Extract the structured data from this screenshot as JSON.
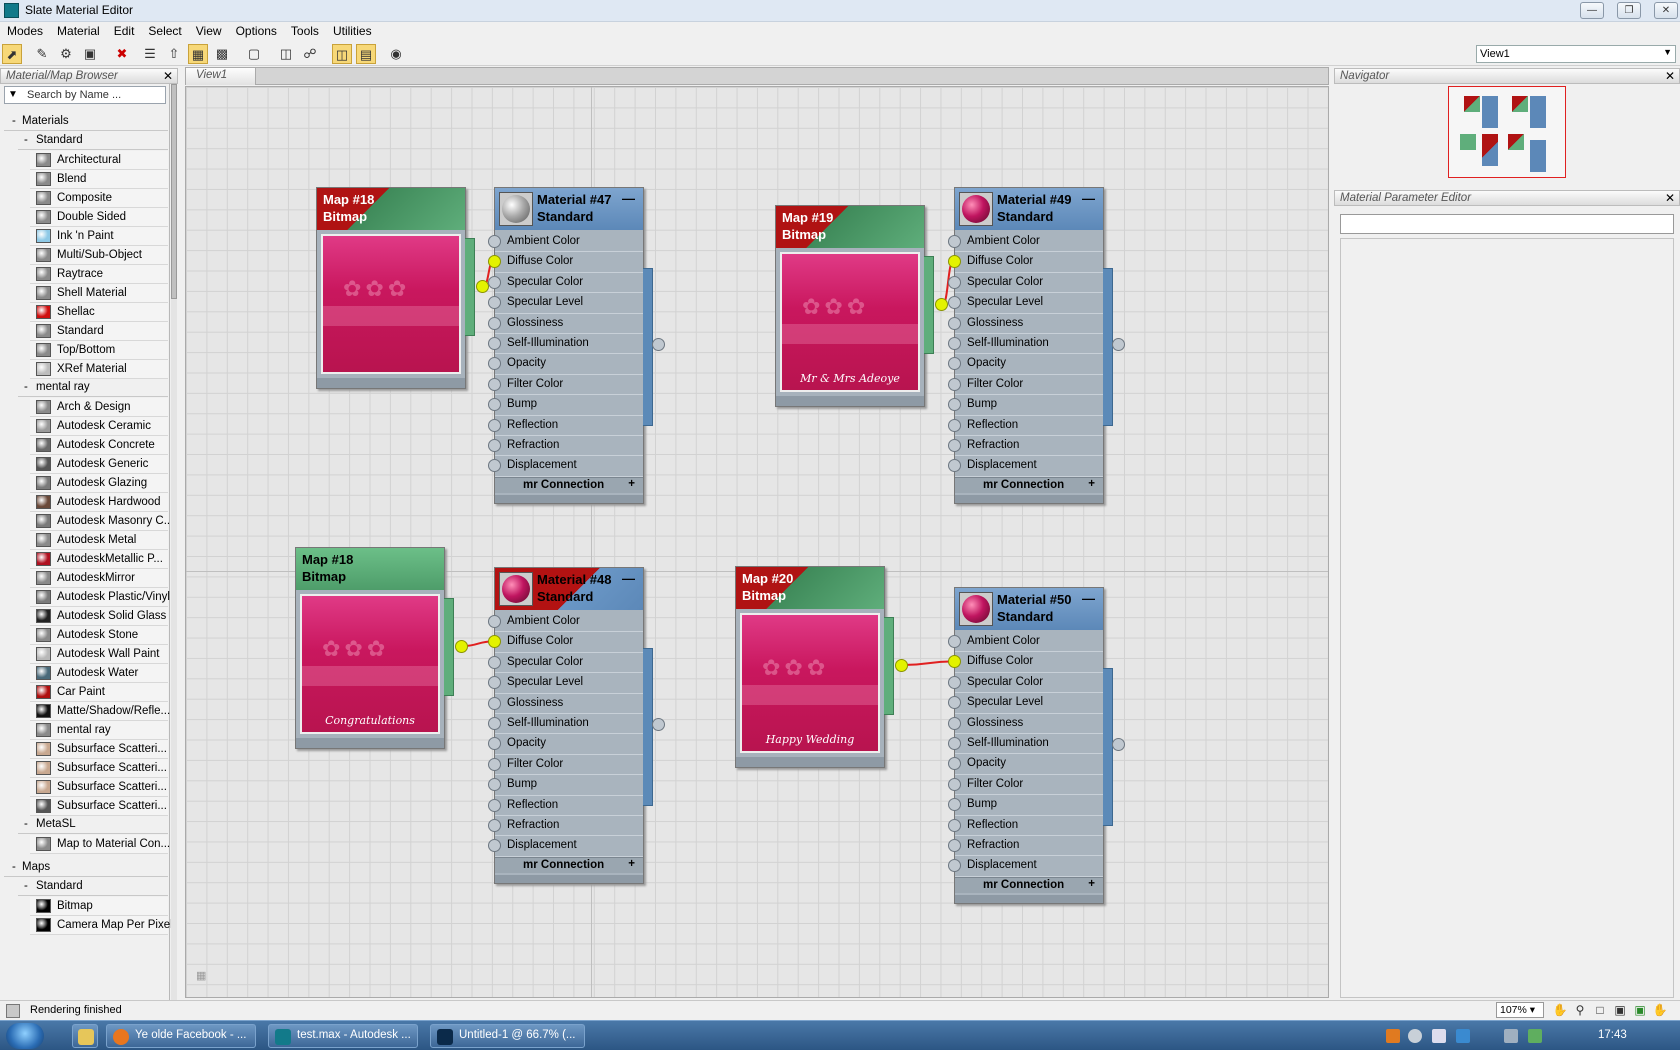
{
  "window": {
    "title": "Slate Material Editor"
  },
  "menu": [
    "Modes",
    "Material",
    "Edit",
    "Select",
    "View",
    "Options",
    "Tools",
    "Utilities"
  ],
  "toolbar": {
    "icons": [
      "select-arrow-icon",
      "pick-material-icon",
      "put-to-scene-icon",
      "assign-to-selection-icon",
      "delete-icon",
      "move-children-icon",
      "hide-unused-slots-icon",
      "show-map-in-viewport-icon",
      "show-background-icon",
      "material-id-icon",
      "layout-all-icon",
      "layout-children-icon",
      "material-map-browser-toggle-icon",
      "parameter-editor-toggle-icon",
      "select-by-material-icon"
    ],
    "view_select": "View1"
  },
  "browser": {
    "title": "Material/Map Browser",
    "search_placeholder": "Search by Name ...",
    "sections": [
      {
        "label": "Materials",
        "sign": "-",
        "groups": [
          {
            "label": "Standard",
            "sign": "-",
            "items": [
              {
                "label": "Architectural",
                "swatch": "#8a8a8a"
              },
              {
                "label": "Blend",
                "swatch": "#8a8a8a"
              },
              {
                "label": "Composite",
                "swatch": "#8a8a8a"
              },
              {
                "label": "Double Sided",
                "swatch": "#8a8a8a"
              },
              {
                "label": "Ink 'n Paint",
                "swatch": "#8ec9e6"
              },
              {
                "label": "Multi/Sub-Object",
                "swatch": "#8a8a8a"
              },
              {
                "label": "Raytrace",
                "swatch": "#8a8a8a"
              },
              {
                "label": "Shell Material",
                "swatch": "#8a8a8a"
              },
              {
                "label": "Shellac",
                "swatch": "#d01010"
              },
              {
                "label": "Standard",
                "swatch": "#8a8a8a"
              },
              {
                "label": "Top/Bottom",
                "swatch": "#8a8a8a"
              },
              {
                "label": "XRef Material",
                "swatch": "#bdbdbd"
              }
            ]
          },
          {
            "label": "mental ray",
            "sign": "-",
            "items": [
              {
                "label": "Arch & Design",
                "swatch": "#8a8a8a"
              },
              {
                "label": "Autodesk Ceramic",
                "swatch": "#9a9a9a"
              },
              {
                "label": "Autodesk Concrete",
                "swatch": "#6a6a6a"
              },
              {
                "label": "Autodesk Generic",
                "swatch": "#555555"
              },
              {
                "label": "Autodesk Glazing",
                "swatch": "#7a7a7a"
              },
              {
                "label": "Autodesk Hardwood",
                "swatch": "#6b4a3a"
              },
              {
                "label": "Autodesk Masonry C...",
                "swatch": "#7a7a7a"
              },
              {
                "label": "Autodesk Metal",
                "swatch": "#8a8a8a"
              },
              {
                "label": "AutodeskMetallic P...",
                "swatch": "#b01020"
              },
              {
                "label": "AutodeskMirror",
                "swatch": "#8a8a8a"
              },
              {
                "label": "Autodesk Plastic/Vinyl",
                "swatch": "#7a7a7a"
              },
              {
                "label": "Autodesk Solid Glass",
                "swatch": "#222222"
              },
              {
                "label": "Autodesk Stone",
                "swatch": "#8a8a8a"
              },
              {
                "label": "Autodesk Wall Paint",
                "swatch": "#b8b8b8"
              },
              {
                "label": "Autodesk Water",
                "swatch": "#4a6a7a"
              },
              {
                "label": "Car Paint",
                "swatch": "#b01010"
              },
              {
                "label": "Matte/Shadow/Refle...",
                "swatch": "#111111"
              },
              {
                "label": "mental ray",
                "swatch": "#8a8a8a"
              },
              {
                "label": "Subsurface Scatteri...",
                "swatch": "#c8a890"
              },
              {
                "label": "Subsurface Scatteri...",
                "swatch": "#c8a890"
              },
              {
                "label": "Subsurface Scatteri...",
                "swatch": "#c8a890"
              },
              {
                "label": "Subsurface Scatteri...",
                "swatch": "#555555"
              }
            ]
          },
          {
            "label": "MetaSL",
            "sign": "-",
            "items": [
              {
                "label": "Map to Material Con...",
                "swatch": "#8a8a8a"
              }
            ]
          }
        ]
      },
      {
        "label": "Maps",
        "sign": "-",
        "groups": [
          {
            "label": "Standard",
            "sign": "-",
            "items": [
              {
                "label": "Bitmap",
                "swatch": "#000000"
              },
              {
                "label": "Camera Map Per Pixel",
                "swatch": "#000000"
              }
            ]
          }
        ]
      }
    ]
  },
  "view_tab": "View1",
  "slot_labels": [
    "Ambient Color",
    "Diffuse Color",
    "Specular Color",
    "Specular Level",
    "Glossiness",
    "Self-Illumination",
    "Opacity",
    "Filter Color",
    "Bump",
    "Reflection",
    "Refraction",
    "Displacement"
  ],
  "mr_label": "mr Connection",
  "maps": [
    {
      "name": "Map #18",
      "type": "Bitmap",
      "caption": "",
      "header": "red-green"
    },
    {
      "name": "Map #19",
      "type": "Bitmap",
      "caption": "Mr & Mrs Adeoye",
      "header": "red-green"
    },
    {
      "name": "Map #18",
      "type": "Bitmap",
      "caption": "Congratulations",
      "header": "green"
    },
    {
      "name": "Map #20",
      "type": "Bitmap",
      "caption": "Happy Wedding",
      "header": "red-green"
    }
  ],
  "materials": [
    {
      "name": "Material #47",
      "type": "Standard",
      "sphere": "grey",
      "header": "blue"
    },
    {
      "name": "Material #49",
      "type": "Standard",
      "sphere": "pink",
      "header": "blue"
    },
    {
      "name": "Material #48",
      "type": "Standard",
      "sphere": "pink",
      "header": "red"
    },
    {
      "name": "Material #50",
      "type": "Standard",
      "sphere": "pink",
      "header": "blue"
    }
  ],
  "navigator": {
    "title": "Navigator"
  },
  "param_editor": {
    "title": "Material Parameter Editor"
  },
  "status": {
    "text": "Rendering finished",
    "zoom": "107%"
  },
  "taskbar": {
    "buttons": [
      {
        "label": "Ye olde Facebook - ...",
        "icon": "firefox-icon"
      },
      {
        "label": "test.max - Autodesk ...",
        "icon": "3dsmax-icon"
      },
      {
        "label": "Untitled-1 @ 66.7% (...",
        "icon": "photoshop-icon"
      }
    ],
    "clock": "17:43"
  },
  "colors": {
    "wire": "#e02020",
    "pin_active": "#e3f200",
    "map_green": "#5fae7b",
    "map_red": "#b01313",
    "mat_blue": "#5c88b8",
    "canvas": "#e6e6e6"
  }
}
